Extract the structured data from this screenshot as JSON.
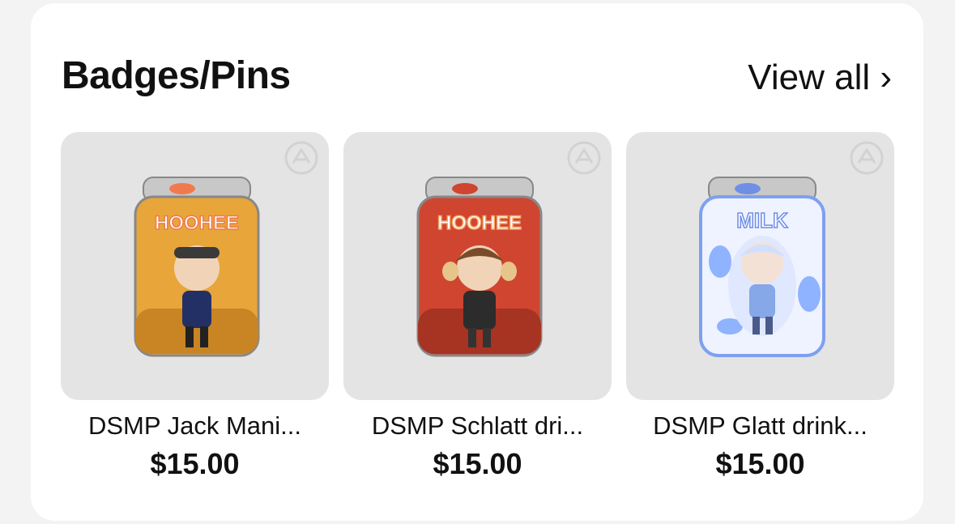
{
  "section": {
    "title": "Badges/Pins",
    "view_all": "View all ›"
  },
  "products": [
    {
      "name": "DSMP Jack Mani...",
      "price": "$15.00",
      "can_label": "HOOHEE",
      "can_color": "#e7a53a",
      "can_dark": "#c98424",
      "label_color": "#f07a4e"
    },
    {
      "name": "DSMP Schlatt dri...",
      "price": "$15.00",
      "can_label": "HOOHEE",
      "can_color": "#d0452f",
      "can_dark": "#a73322",
      "label_color": "#f3a466"
    },
    {
      "name": "DSMP Glatt drink...",
      "price": "$15.00",
      "can_label": "MILK",
      "can_color": "#e8f0ff",
      "can_dark": "#6f8fe6",
      "label_color": "#8fb3ff"
    }
  ]
}
